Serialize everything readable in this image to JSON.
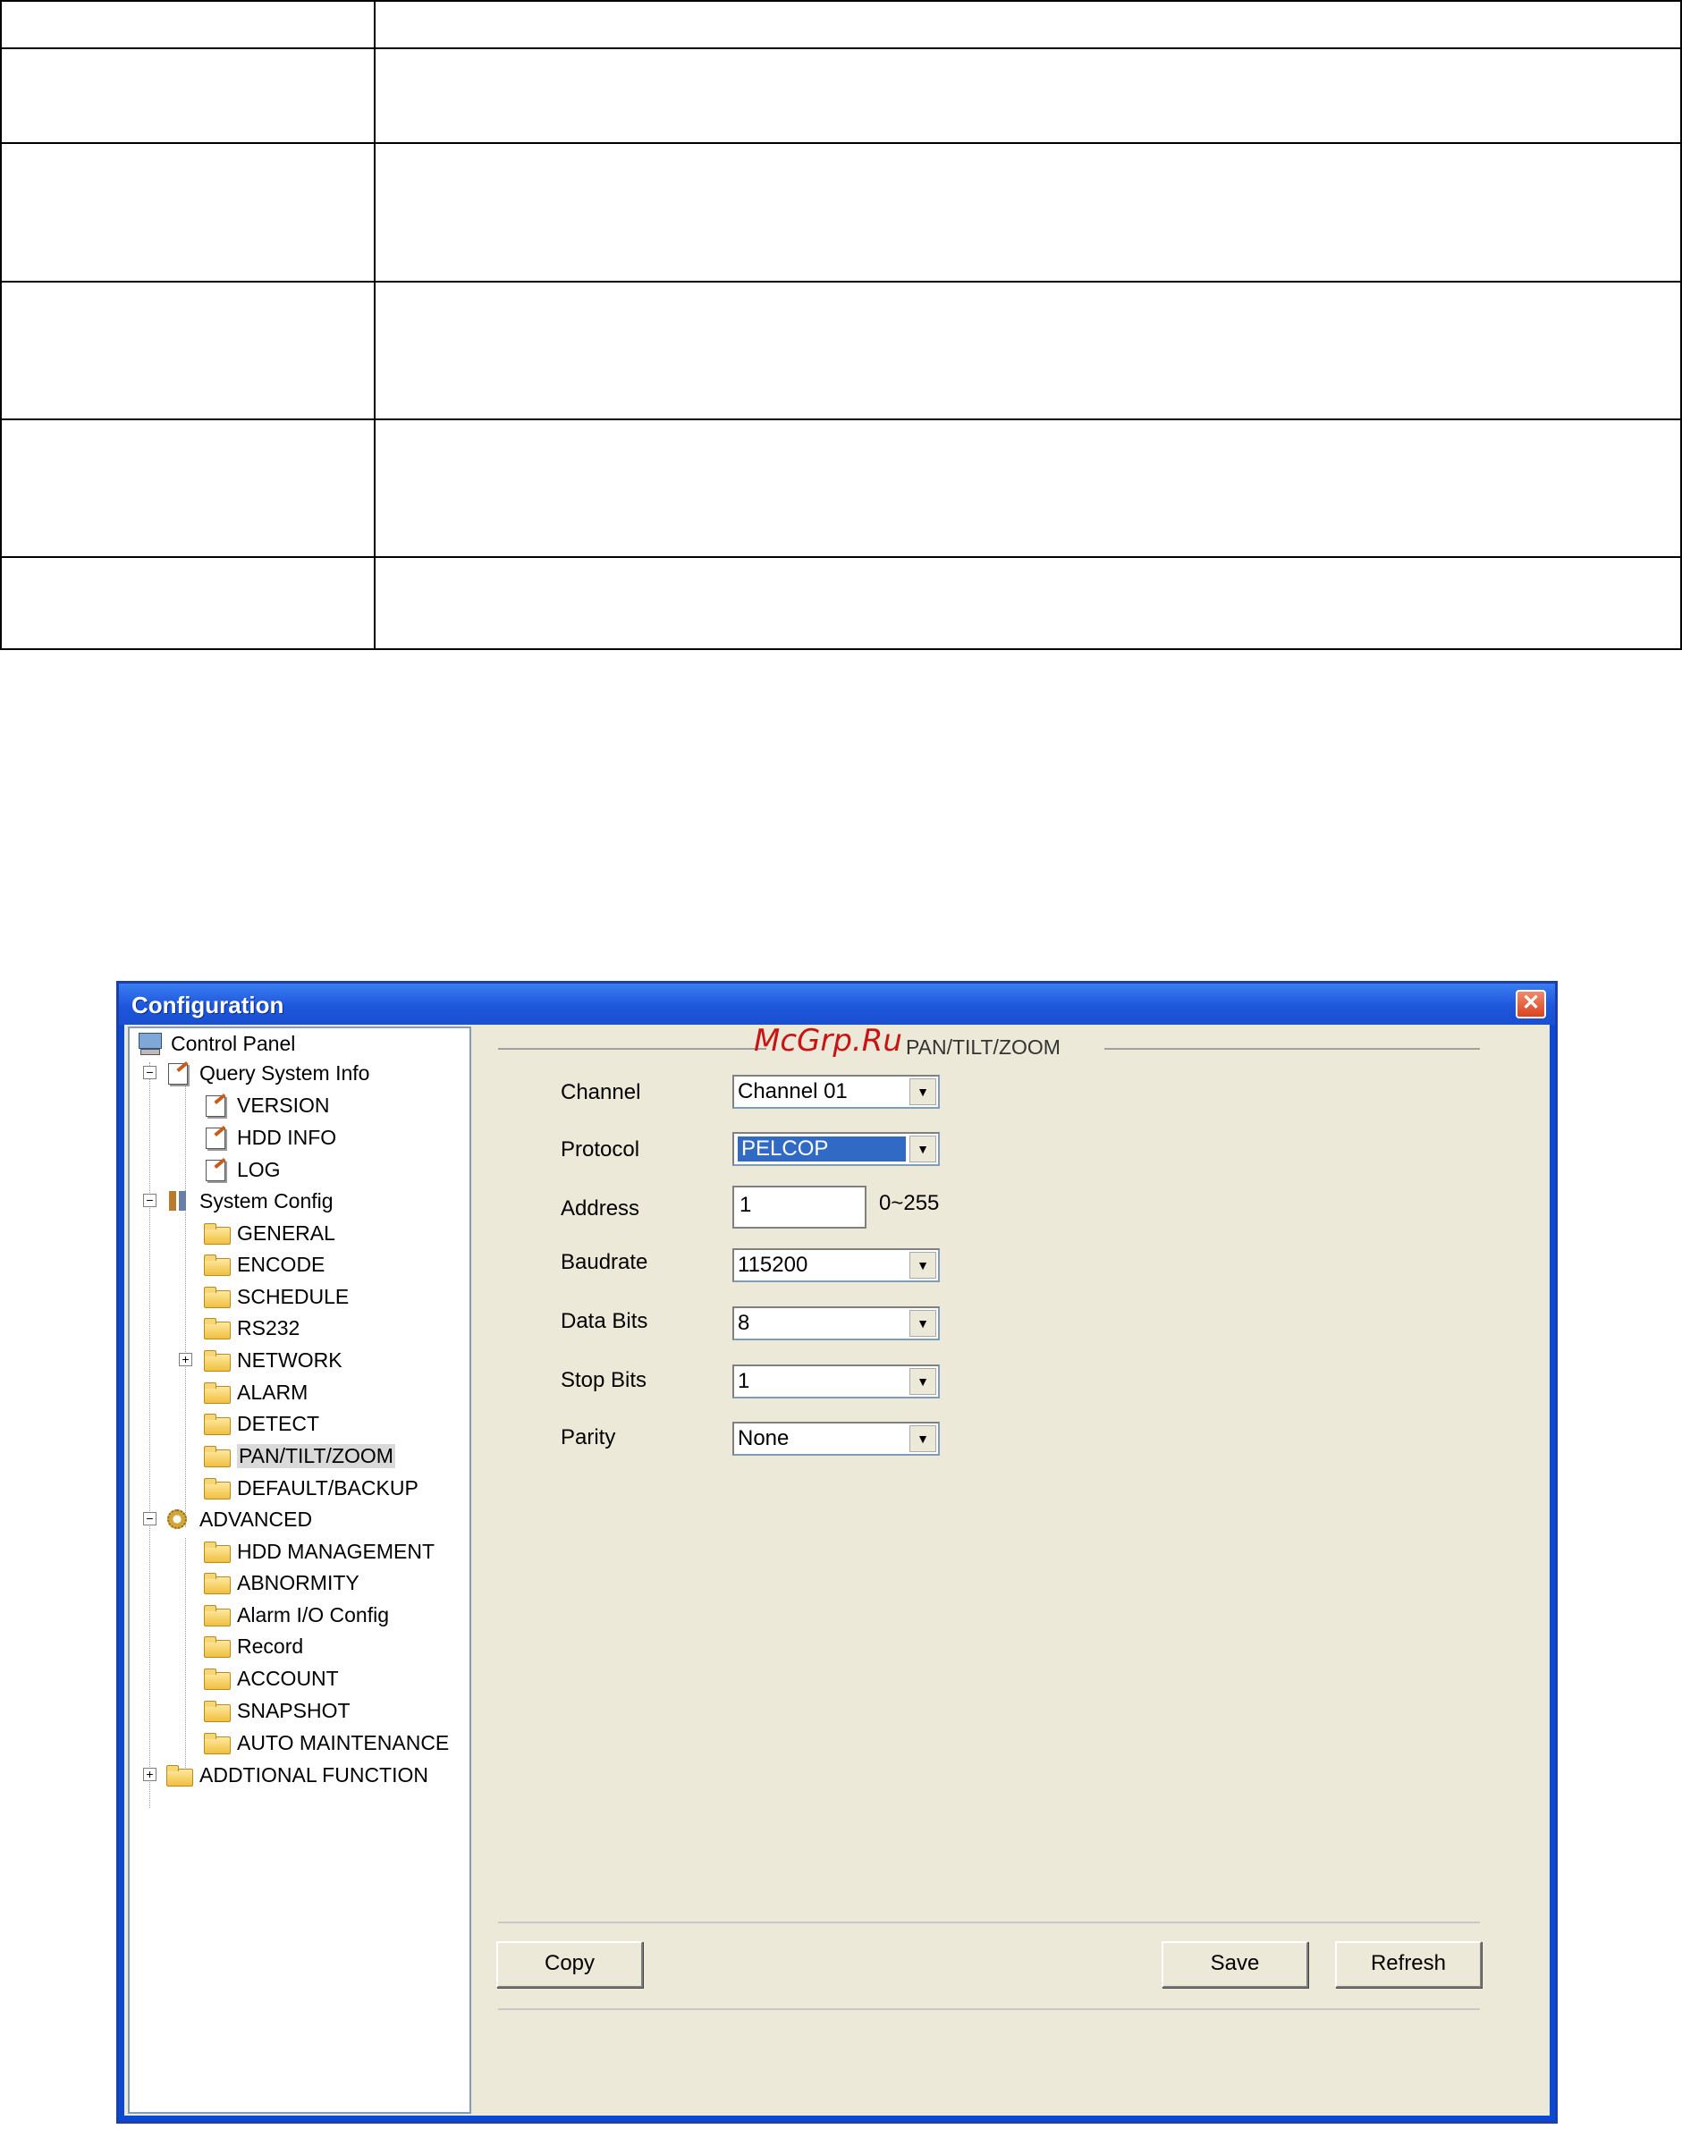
{
  "window": {
    "title": "Configuration",
    "close_glyph": "✕"
  },
  "watermark": "McGrp.Ru",
  "tree": {
    "root": "Control Panel",
    "query_system_info": "Query System Info",
    "version": "VERSION",
    "hdd_info": "HDD INFO",
    "log": "LOG",
    "system_config": "System Config",
    "general": "GENERAL",
    "encode": "ENCODE",
    "schedule": "SCHEDULE",
    "rs232": "RS232",
    "network": "NETWORK",
    "alarm": "ALARM",
    "detect": "DETECT",
    "ptz": "PAN/TILT/ZOOM",
    "default_backup": "DEFAULT/BACKUP",
    "advanced": "ADVANCED",
    "hdd_management": "HDD MANAGEMENT",
    "abnormity": "ABNORMITY",
    "alarm_io": "Alarm I/O Config",
    "record": "Record",
    "account": "ACCOUNT",
    "snapshot": "SNAPSHOT",
    "auto_maintenance": "AUTO MAINTENANCE",
    "additional": "ADDTIONAL FUNCTION",
    "expand_minus": "−",
    "expand_plus": "+"
  },
  "ptz": {
    "section_title": "PAN/TILT/ZOOM",
    "channel_label": "Channel",
    "channel_value": "Channel 01",
    "protocol_label": "Protocol",
    "protocol_value": "PELCOP",
    "address_label": "Address",
    "address_value": "1",
    "address_range": "0~255",
    "baudrate_label": "Baudrate",
    "baudrate_value": "115200",
    "databits_label": "Data Bits",
    "databits_value": "8",
    "stopbits_label": "Stop Bits",
    "stopbits_value": "1",
    "parity_label": "Parity",
    "parity_value": "None",
    "dropdown_glyph": "▼"
  },
  "buttons": {
    "copy": "Copy",
    "save": "Save",
    "refresh": "Refresh"
  }
}
